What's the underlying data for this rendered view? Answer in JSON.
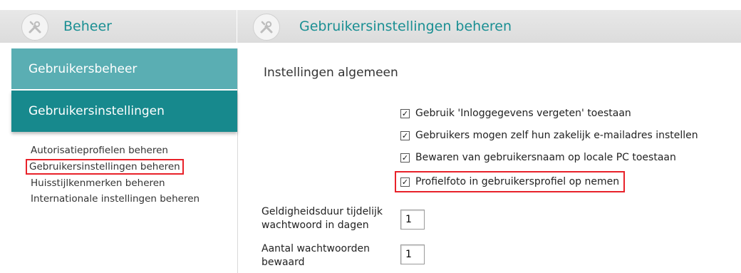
{
  "header": {
    "left_title": "Beheer",
    "right_title": "Gebruikersinstellingen beheren",
    "icon": "tools-icon"
  },
  "sidebar": {
    "nav_items": [
      {
        "label": "Gebruikersbeheer"
      },
      {
        "label": "Gebruikersinstellingen"
      }
    ],
    "sub_items": [
      {
        "label": "Autorisatieprofielen beheren"
      },
      {
        "label": "Gebruikersinstellingen beheren"
      },
      {
        "label": "Huisstijlkenmerken beheren"
      },
      {
        "label": "Internationale instellingen beheren"
      }
    ],
    "highlight_color": "#e8222a",
    "accent_color": "#17898d"
  },
  "main": {
    "section_title": "Instellingen algemeen",
    "checkboxes": [
      {
        "label": "Gebruik 'Inloggegevens vergeten' toestaan",
        "checked": true
      },
      {
        "label": "Gebruikers mogen zelf hun zakelijk e-mailadres instellen",
        "checked": true
      },
      {
        "label": "Bewaren van gebruikersnaam op locale PC toestaan",
        "checked": true
      },
      {
        "label": "Profielfoto in gebruikersprofiel op nemen",
        "checked": true
      }
    ],
    "fields": [
      {
        "label": "Geldigheidsduur tijdelijk wachtwoord in dagen",
        "value": "1"
      },
      {
        "label": "Aantal wachtwoorden bewaard",
        "value": "1"
      }
    ]
  }
}
